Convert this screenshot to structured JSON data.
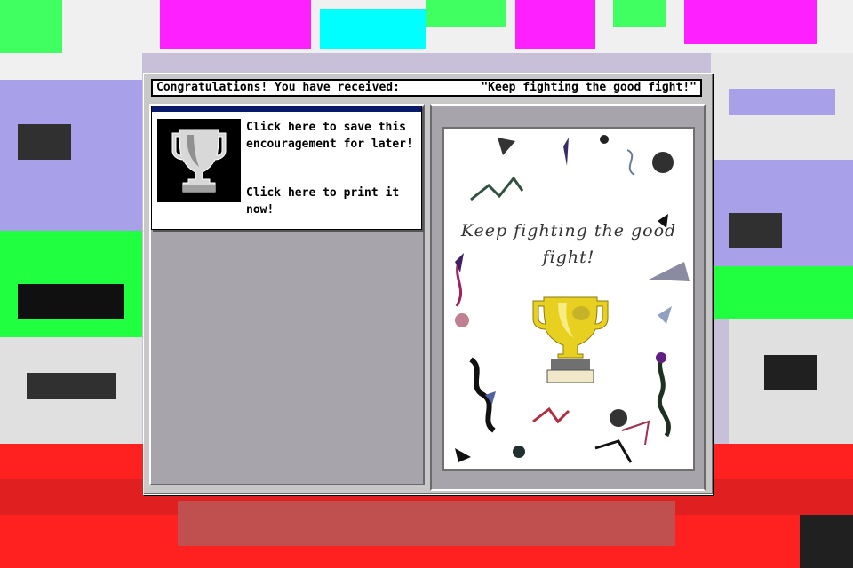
{
  "dialog": {
    "title_prefix": "Congratulations! You have received:",
    "title_quote": "\"Keep fighting the good fight!\""
  },
  "actions": {
    "save_label": "Click here to save this encouragement for later!",
    "print_label": "Click here to print it now!"
  },
  "card": {
    "message": "Keep fighting the good fight!"
  },
  "icons": {
    "trophy": "trophy-icon",
    "gold_trophy": "gold-trophy-icon"
  },
  "colors": {
    "dialog_bg": "#c8c8c8",
    "pane_bg": "#a7a4ab",
    "card_header": "#0a1a6a",
    "trophy_gold": "#e8d020"
  }
}
